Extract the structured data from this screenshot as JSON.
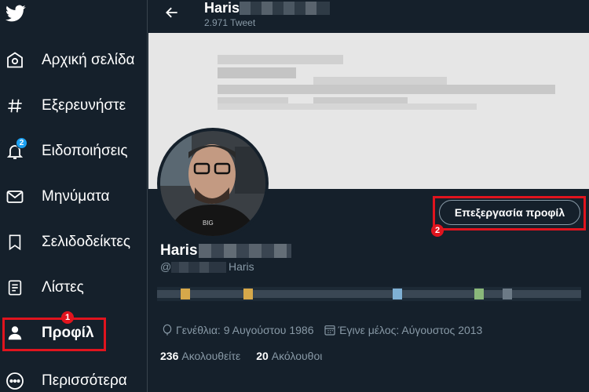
{
  "sidebar": {
    "items": [
      {
        "label": "Αρχική σελίδα",
        "icon": "home-icon"
      },
      {
        "label": "Εξερευνήστε",
        "icon": "hashtag-icon"
      },
      {
        "label": "Ειδοποιήσεις",
        "icon": "bell-icon",
        "badge": "2"
      },
      {
        "label": "Μηνύματα",
        "icon": "mail-icon"
      },
      {
        "label": "Σελιδοδείκτες",
        "icon": "bookmark-icon"
      },
      {
        "label": "Λίστες",
        "icon": "list-icon"
      },
      {
        "label": "Προφίλ",
        "icon": "person-icon"
      },
      {
        "label": "Περισσότερα",
        "icon": "more-icon"
      }
    ]
  },
  "annotations": {
    "marker_1": "1",
    "marker_2": "2",
    "color": "#e0141e"
  },
  "header": {
    "name": "Haris",
    "tweet_count": "2.971 Tweet"
  },
  "profile": {
    "name": "Haris",
    "handle_prefix": "@",
    "handle_suffix": "Haris",
    "edit_button": "Επεξεργασία προφίλ",
    "birthday": "Γενέθλια: 9 Αυγούστου 1986",
    "joined": "Έγινε μέλος: Αύγουστος 2013",
    "following_count": "236",
    "following_label": "Ακολουθείτε",
    "followers_count": "20",
    "followers_label": "Ακόλουθοι",
    "avatar_shirt_text": "BIG"
  },
  "colors": {
    "background": "#15202b",
    "accent": "#1da1f2",
    "muted": "#8899a6",
    "border": "#38444d"
  }
}
